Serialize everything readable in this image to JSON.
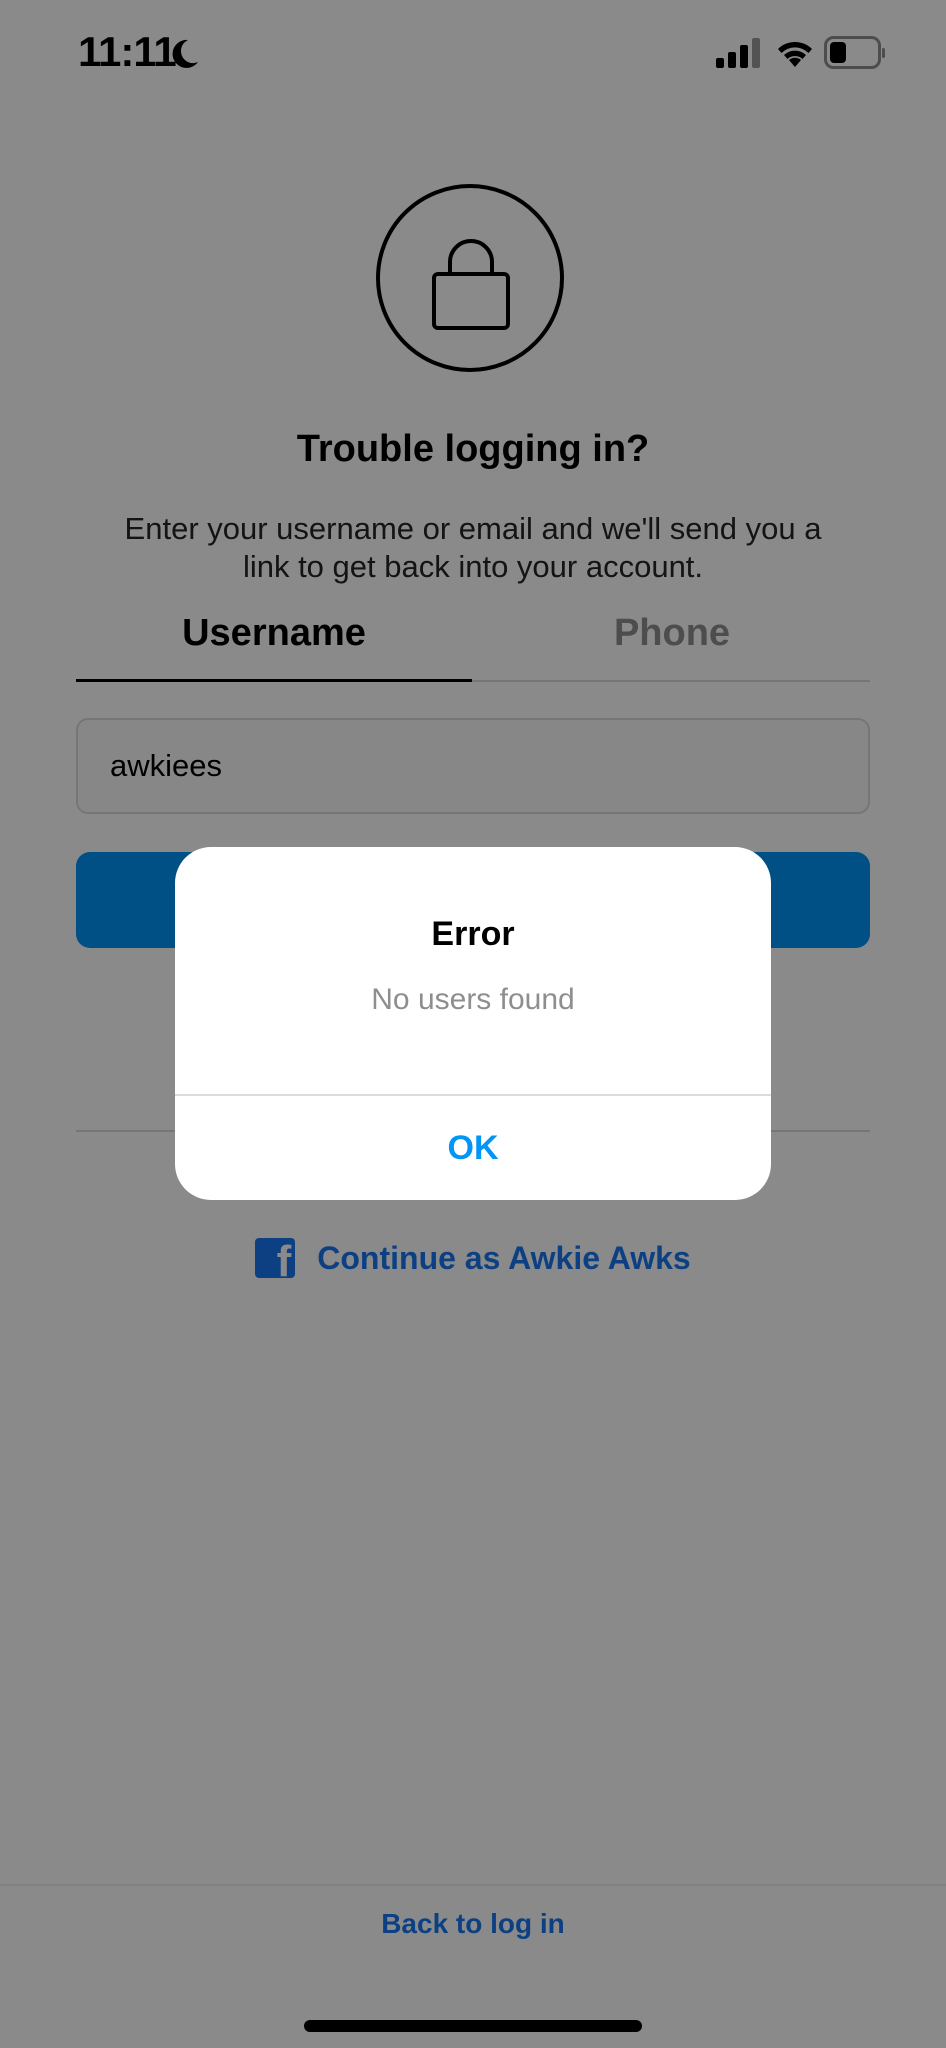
{
  "status_bar": {
    "time": "11:11",
    "icons": [
      "moon-icon",
      "cellular-signal-icon",
      "wifi-icon",
      "battery-icon"
    ]
  },
  "header": {
    "icon": "lock-icon",
    "title": "Trouble logging in?",
    "subtitle": "Enter your username or email and we'll send you a link to get back into your account."
  },
  "tabs": [
    {
      "label": "Username",
      "selected": true
    },
    {
      "label": "Phone",
      "selected": false
    }
  ],
  "form": {
    "username_value": "awkiees"
  },
  "facebook": {
    "icon": "facebook-icon",
    "label": "Continue as Awkie Awks"
  },
  "footer": {
    "back_link": "Back to log in"
  },
  "dialog": {
    "title": "Error",
    "message": "No users found",
    "ok_label": "OK"
  },
  "colors": {
    "accent": "#0095f6",
    "facebook_blue": "#1877f2",
    "overlay": "rgba(0,0,0,0.46)"
  }
}
